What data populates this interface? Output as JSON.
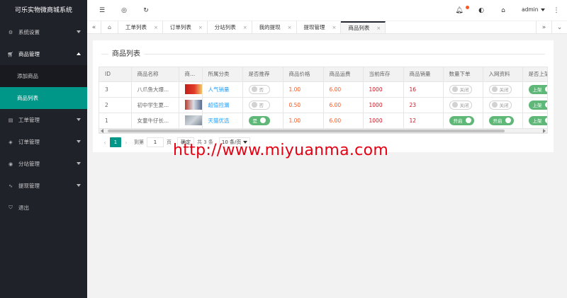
{
  "app": {
    "title": "可乐实物微商城系统"
  },
  "sidebar": {
    "items": [
      {
        "label": "系统设置",
        "icon": "gear-icon"
      },
      {
        "label": "商品管理",
        "icon": "cart-icon",
        "open": true,
        "children": [
          {
            "label": "添加商品"
          },
          {
            "label": "商品列表",
            "active": true
          }
        ]
      },
      {
        "label": "工单管理",
        "icon": "file-icon"
      },
      {
        "label": "订单管理",
        "icon": "box-icon"
      },
      {
        "label": "分站管理",
        "icon": "globe-icon"
      },
      {
        "label": "提现管理",
        "icon": "pulse-icon"
      },
      {
        "label": "退出",
        "icon": "shield-icon"
      }
    ]
  },
  "header": {
    "user": "admin"
  },
  "tabs": [
    {
      "label": "工单列表"
    },
    {
      "label": "订单列表"
    },
    {
      "label": "分站列表"
    },
    {
      "label": "我的提现"
    },
    {
      "label": "提现管理"
    },
    {
      "label": "商品列表",
      "active": true
    }
  ],
  "card": {
    "title": "商品列表"
  },
  "table": {
    "headers": [
      "ID",
      "商品名称",
      "商...",
      "所属分类",
      "是否推荐",
      "商品价格",
      "商品运费",
      "当前库存",
      "商品销量",
      "数量下单",
      "入网资料",
      "是否上架"
    ],
    "rows": [
      {
        "id": "3",
        "name": "八爪鱼大爆...",
        "category": "人气销量",
        "recommend": "否",
        "price": "1.00",
        "freight": "6.00",
        "stock": "1000",
        "sales": "16",
        "qty": "关闭",
        "net": "关闭",
        "shelf": "上架"
      },
      {
        "id": "2",
        "name": "初中学生夏...",
        "category": "超值捡漏",
        "recommend": "否",
        "price": "0.50",
        "freight": "6.00",
        "stock": "1000",
        "sales": "23",
        "qty": "关闭",
        "net": "关闭",
        "shelf": "上架"
      },
      {
        "id": "1",
        "name": "女童牛仔长...",
        "category": "天猫优选",
        "recommend": "是",
        "price": "1.00",
        "freight": "6.00",
        "stock": "1000",
        "sales": "12",
        "qty": "开启",
        "net": "开启",
        "shelf": "上架"
      }
    ]
  },
  "pager": {
    "current": "1",
    "goto_label": "到第",
    "goto_value": "1",
    "page_unit": "页",
    "confirm": "确定",
    "total": "共 3 条",
    "per_page": "10 条/页"
  },
  "watermark": "http://www.miyuanma.com",
  "colors": {
    "accent": "#009688",
    "sidebar_bg": "#20222a",
    "switch_on": "#5fb878",
    "price": "#ff5722",
    "category": "#1e9fff"
  }
}
